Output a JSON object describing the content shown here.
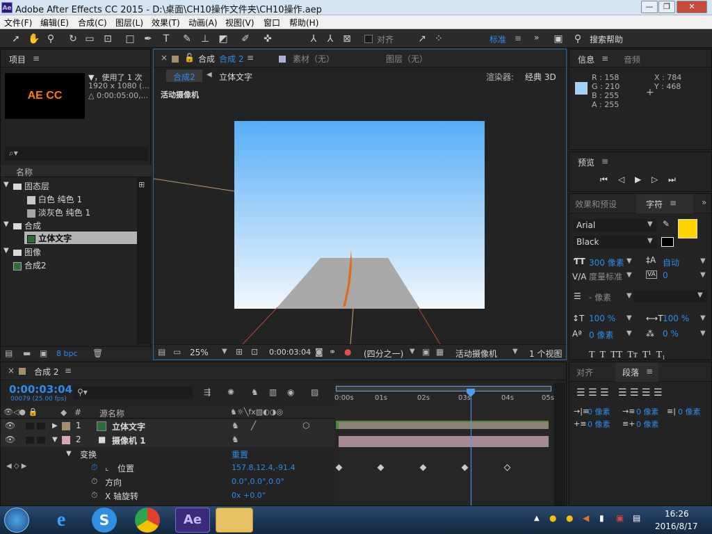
{
  "window": {
    "title": "Adobe After Effects CC 2015 - D:\\桌面\\CH10操作文件夹\\CH10操作.aep",
    "app_icon": "Ae",
    "min": "—",
    "max": "❐",
    "close": "✕"
  },
  "menu": [
    "文件(F)",
    "编辑(E)",
    "合成(C)",
    "图层(L)",
    "效果(T)",
    "动画(A)",
    "视图(V)",
    "窗口",
    "帮助(H)"
  ],
  "toolbar": {
    "snap_label": "对齐",
    "workspace": "标准",
    "more": "»",
    "search_placeholder": "搜索帮助"
  },
  "project": {
    "title": "项目",
    "thumb_text": "AE CC",
    "info_line1": "▼，使用了 1 次",
    "info_line2": "1920 x 1080 (...",
    "info_line3": "△ 0:00:05:00,...",
    "search_icon": "⌕▾",
    "col_name": "名称",
    "tree": [
      {
        "label": "固态层",
        "type": "folder",
        "indent": 0
      },
      {
        "label": "白色 纯色 1",
        "type": "solid",
        "indent": 1
      },
      {
        "label": "淡灰色 纯色 1",
        "type": "solid",
        "indent": 1
      },
      {
        "label": "合成",
        "type": "folder",
        "indent": 0
      },
      {
        "label": "立体文字",
        "type": "comp",
        "indent": 1,
        "selected": true
      },
      {
        "label": "图像",
        "type": "folder",
        "indent": 0
      },
      {
        "label": "合成2",
        "type": "comp",
        "indent": 0
      }
    ],
    "bpc": "8 bpc"
  },
  "comp_viewer": {
    "tab_comp": "合成",
    "tab_comp_name": "合成 2",
    "tab_footage": "素材（无）",
    "tab_layer": "图层（无）",
    "crumb1": "合成2",
    "crumb2": "立体文字",
    "renderer_label": "渲染器:",
    "renderer_value": "经典 3D",
    "camera_label": "活动摄像机",
    "zoom": "25%",
    "timecode": "0:00:03:04",
    "resolution": "(四分之一)",
    "view": "活动摄像机",
    "views": "1 个视图"
  },
  "info": {
    "tab_info": "信息",
    "tab_audio": "音频",
    "r": "R : 158",
    "g": "G : 210",
    "b": "B : 255",
    "a": "A : 255",
    "x": "X : 784",
    "y": "Y : 468",
    "swatch_color": "#9ed2ff"
  },
  "preview": {
    "title": "预览"
  },
  "effects": {
    "tab_effects": "效果和预设",
    "tab_char": "字符"
  },
  "character": {
    "font": "Arial",
    "style": "Black",
    "size": "300 像素",
    "leading": "自动",
    "kerning": "度量标准",
    "tracking": "0",
    "stroke": "- 像素",
    "vscale": "100 %",
    "hscale": "100 %",
    "baseline": "0 像素",
    "tsume": "0 %",
    "fill_color": "#ffd400"
  },
  "paragraph": {
    "tab_align": "对齐",
    "tab_para": "段落",
    "indent_left": "0 像素",
    "indent_first": "0 像素",
    "indent_right": "0 像素",
    "space_before": "0 像素",
    "space_after": "0 像素"
  },
  "timeline": {
    "tab": "合成 2",
    "timecode": "0:00:03:04",
    "frames": "00079 (25.00 fps)",
    "col_num": "#",
    "col_source": "源名称",
    "reset": "重置",
    "ruler": [
      "0:00s",
      "01s",
      "02s",
      "03s",
      "04s",
      "05s"
    ],
    "layers": [
      {
        "num": "1",
        "name": "立体文字",
        "color": "#a48f6a"
      },
      {
        "num": "2",
        "name": "摄像机 1",
        "color": "#d7a6bd"
      }
    ],
    "transform": "变换",
    "props": [
      {
        "name": "位置",
        "value": "157.8,12.4,-91.4"
      },
      {
        "name": "方向",
        "value": "0.0°,0.0°,0.0°"
      },
      {
        "name": "X 轴旋转",
        "value": "0x +0.0°"
      }
    ],
    "bar_color_1": "#8d8374",
    "bar_color_2": "#a58a96"
  },
  "taskbar": {
    "time": "16:26",
    "date": "2016/8/17"
  }
}
